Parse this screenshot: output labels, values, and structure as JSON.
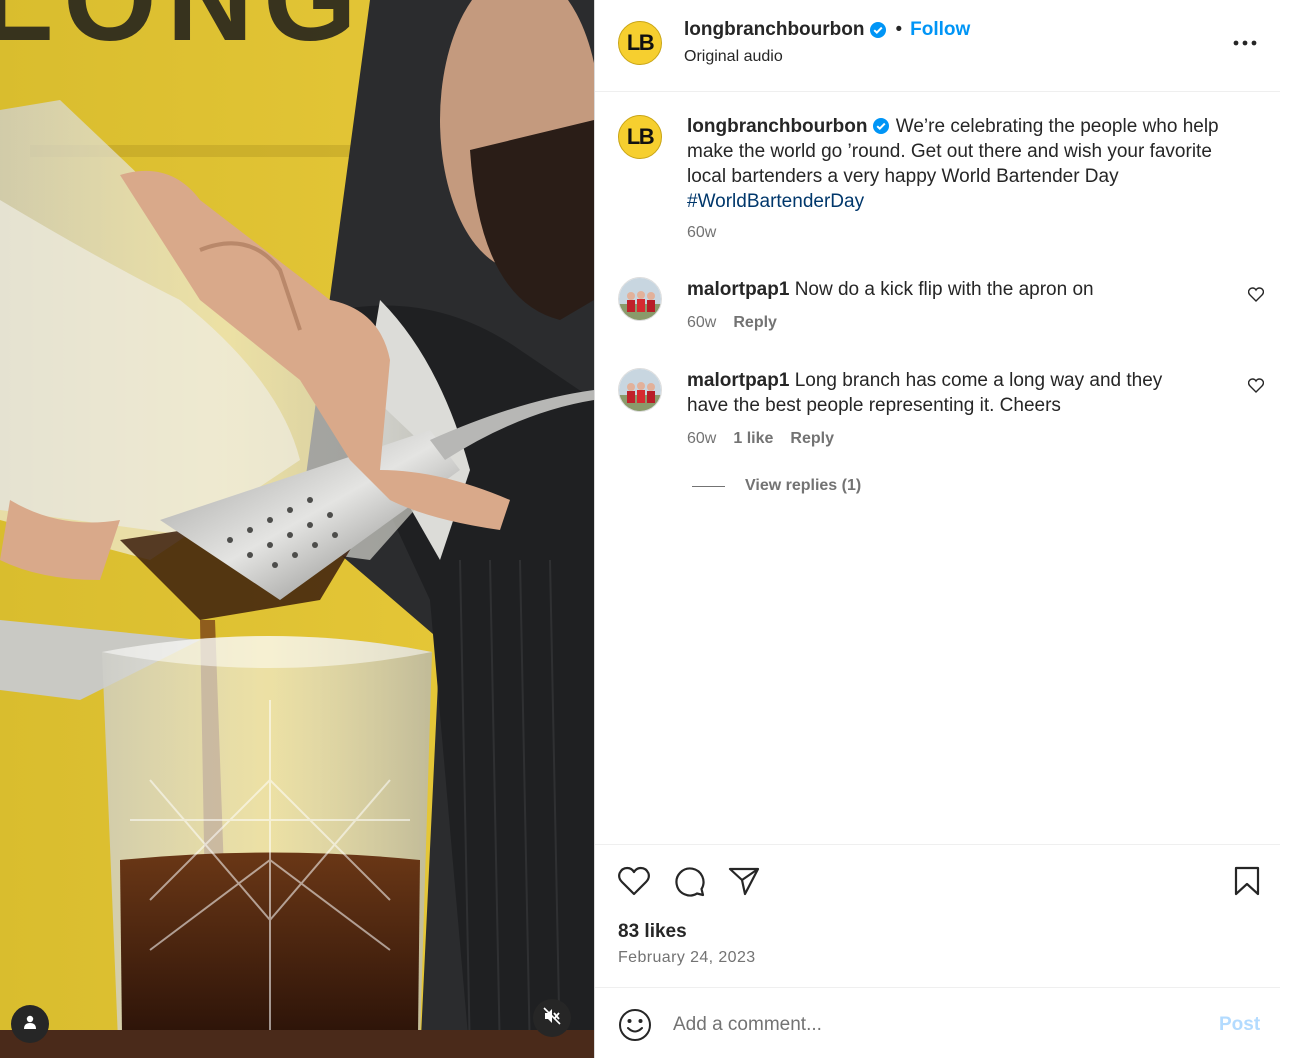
{
  "colors": {
    "accent": "#0095f6",
    "hashtag": "#00376b",
    "secondary_text": "#737373",
    "brand_yellow": "#f6cf2f",
    "post_disabled": "#b3dbff"
  },
  "media": {
    "backdrop_letters": "LONG",
    "tag_icon": "person-icon",
    "mute_icon": "speaker-muted-icon"
  },
  "header": {
    "avatar_text": "LB",
    "username": "longbranchbourbon",
    "separator": "•",
    "follow_label": "Follow",
    "subtitle": "Original audio",
    "more_icon": "more-horizontal-icon"
  },
  "caption": {
    "avatar_text": "LB",
    "username": "longbranchbourbon",
    "text": "We’re celebrating the people who help make the world go ’round. Get out there and wish your favorite local bartenders a very happy World Bartender Day",
    "hashtag": "#WorldBartenderDay",
    "age": "60w"
  },
  "comments": [
    {
      "username": "malortpap1",
      "text": "Now do a kick flip with the apron on",
      "age": "60w",
      "likes": "",
      "reply_label": "Reply"
    },
    {
      "username": "malortpap1",
      "text": "Long branch has come a long way and they have the best people representing it. Cheers",
      "age": "60w",
      "likes": "1 like",
      "reply_label": "Reply"
    }
  ],
  "view_replies_label": "View replies (1)",
  "actions": {
    "icons": [
      "heart-icon",
      "comment-icon",
      "share-icon",
      "bookmark-icon"
    ],
    "likes": "83 likes",
    "date": "February 24, 2023"
  },
  "add_comment": {
    "placeholder": "Add a comment...",
    "post_label": "Post",
    "emoji_icon": "emoji-icon"
  }
}
